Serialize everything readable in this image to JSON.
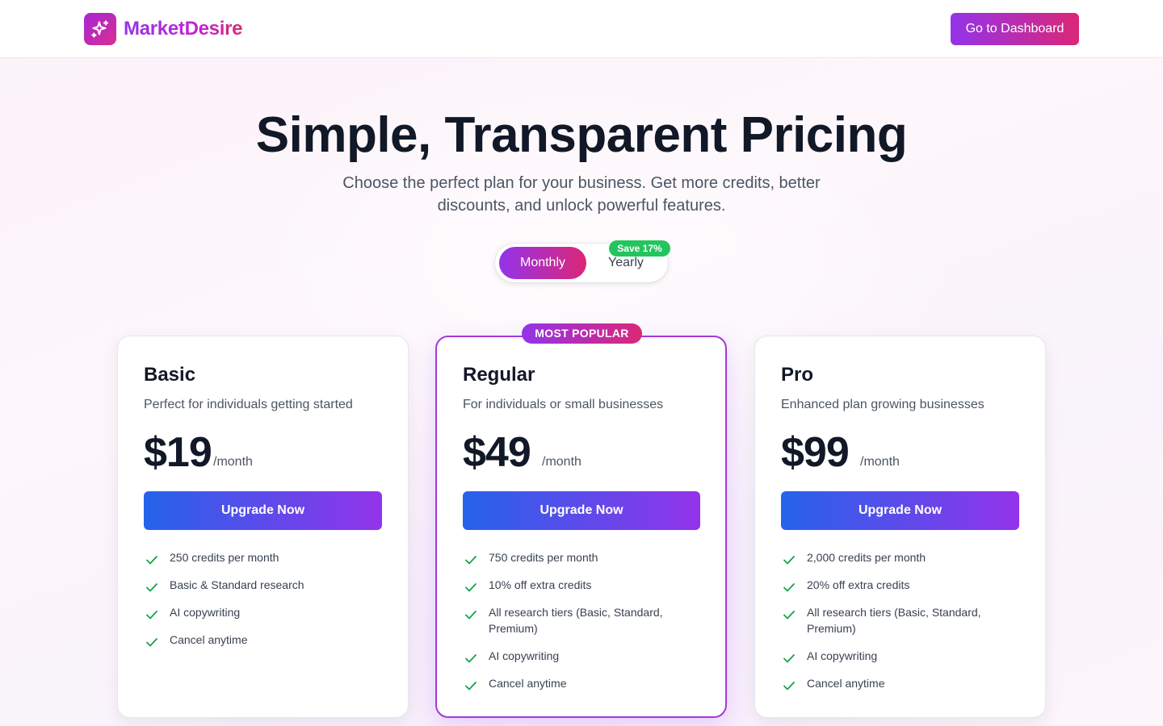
{
  "header": {
    "brand": "MarketDesire",
    "dashboard_button": "Go to Dashboard"
  },
  "hero": {
    "title": "Simple, Transparent Pricing",
    "subtitle": "Choose the perfect plan for your business. Get more credits, better discounts, and unlock powerful features."
  },
  "billing_toggle": {
    "monthly": "Monthly",
    "yearly": "Yearly",
    "save_badge": "Save 17%",
    "selected": "Monthly"
  },
  "colors": {
    "brand_gradient_start": "#9333ea",
    "brand_gradient_end": "#db2777",
    "button_gradient_start": "#2563eb",
    "button_gradient_end": "#9333ea",
    "check": "#16a34a",
    "save_badge": "#22c55e"
  },
  "plans": [
    {
      "name": "Basic",
      "description": "Perfect for individuals getting started",
      "price": "$19",
      "period": "/month",
      "button": "Upgrade Now",
      "features": [
        "250 credits per month",
        "Basic & Standard research",
        "AI copywriting",
        "Cancel anytime"
      ]
    },
    {
      "name": "Regular",
      "badge": "MOST POPULAR",
      "description": "For individuals or small businesses",
      "price": "$49",
      "period": "/month",
      "button": "Upgrade Now",
      "features": [
        "750 credits per month",
        "10% off extra credits",
        "All research tiers (Basic, Standard, Premium)",
        "AI copywriting",
        "Cancel anytime"
      ]
    },
    {
      "name": "Pro",
      "description": "Enhanced plan growing businesses",
      "price": "$99",
      "period": "/month",
      "button": "Upgrade Now",
      "features": [
        "2,000 credits per month",
        "20% off extra credits",
        "All research tiers (Basic, Standard, Premium)",
        "AI copywriting",
        "Cancel anytime"
      ]
    }
  ]
}
